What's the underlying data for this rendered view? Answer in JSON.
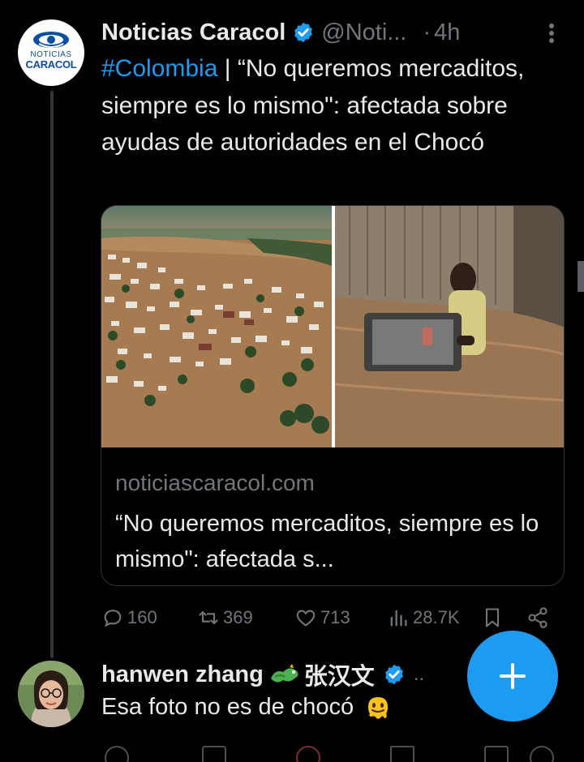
{
  "tweet": {
    "author": {
      "display_name": "Noticias Caracol",
      "handle": "@Noti...",
      "separator": "·",
      "time": "4h",
      "verified": true,
      "avatar_text_top": "NOTICIAS",
      "avatar_text_bottom": "CARACOL"
    },
    "text": {
      "hashtag": "#Colombia",
      "body": " | “No queremos mercaditos, siempre es lo mismo\": afectada sobre ayudas de autoridades en el Chocó"
    },
    "card": {
      "domain": "noticiascaracol.com",
      "title": "“No queremos mercaditos, siempre es lo mismo\": afectada s..."
    },
    "actions": {
      "replies": "160",
      "retweets": "369",
      "likes": "713",
      "views": "28.7K",
      "icons": [
        "reply-icon",
        "retweet-icon",
        "like-icon",
        "views-icon",
        "bookmark-icon",
        "share-icon"
      ]
    }
  },
  "reply": {
    "display_name": "hanwen zhang",
    "name_suffix": "张汉文",
    "verified": true,
    "ellipsis": "..",
    "text": "Esa foto no es de chocó"
  },
  "fab": {
    "icon": "plus-icon"
  },
  "colors": {
    "background": "#000000",
    "text": "#e7e9ea",
    "muted": "#71767b",
    "accent": "#1d9bf0",
    "border": "#2f3336"
  }
}
